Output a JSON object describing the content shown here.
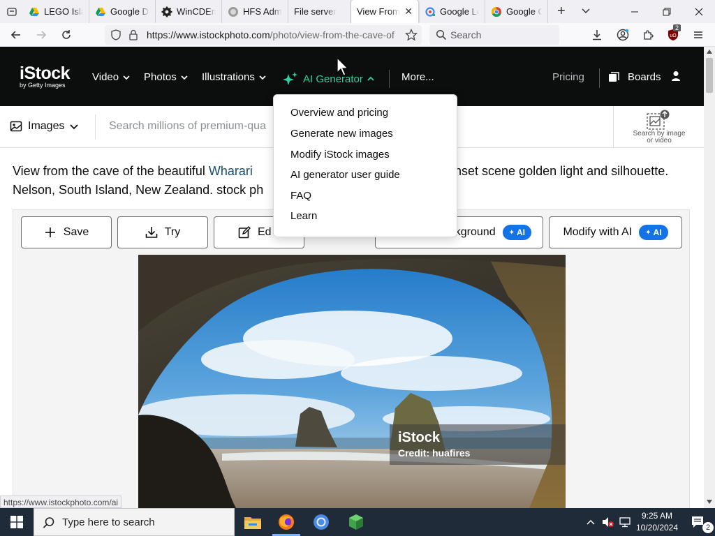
{
  "browser": {
    "tabs": [
      {
        "label": "LEGO Islan",
        "icon": "google-drive-icon"
      },
      {
        "label": "Google Dr",
        "icon": "google-drive-icon"
      },
      {
        "label": "WinCDEm",
        "icon": "gear-icon"
      },
      {
        "label": "HFS Admin",
        "icon": "hfs-icon"
      },
      {
        "label": "File server",
        "icon": ""
      },
      {
        "label": "View From",
        "icon": "",
        "active": true
      },
      {
        "label": "Google Le",
        "icon": "google-lens-icon"
      },
      {
        "label": "Google Ch",
        "icon": "chrome-icon"
      }
    ],
    "url_host": "https://www.istockphoto.com",
    "url_path": "/photo/view-from-the-cave-of",
    "search_placeholder": "Search",
    "extension_badge": "2",
    "status_url": "https://www.istockphoto.com/ai"
  },
  "site": {
    "logo_main": "iStock",
    "logo_sub": "by Getty Images",
    "nav": {
      "video": "Video",
      "photos": "Photos",
      "illustrations": "Illustrations",
      "ai_generator": "AI Generator",
      "more": "More...",
      "pricing": "Pricing",
      "boards": "Boards"
    },
    "accent_color": "#2fd0a0",
    "search": {
      "type_label": "Images",
      "placeholder": "Search millions of premium-qua",
      "by_image_line1": "Search by image",
      "by_image_line2": "or video"
    },
    "title_before": "View from the cave of the beautiful ",
    "title_highlight": "Wharari",
    "title_after_line1": "nset scene golden light and silhouette.",
    "title_line2": "Nelson, South Island, New Zealand. stock ph",
    "actions": {
      "save": "Save",
      "try": "Try",
      "edit": "Ed",
      "background": "kground",
      "modify": "Modify with AI",
      "ai_badge": "AI"
    },
    "credit_logo": "iStock",
    "credit_text": "Credit: huafires"
  },
  "dropdown": {
    "items": [
      "Overview and pricing",
      "Generate new images",
      "Modify iStock images",
      "AI generator user guide",
      "FAQ",
      "Learn"
    ]
  },
  "taskbar": {
    "search_placeholder": "Type here to search",
    "time": "9:25 AM",
    "date": "10/20/2024",
    "notification_count": "2"
  }
}
